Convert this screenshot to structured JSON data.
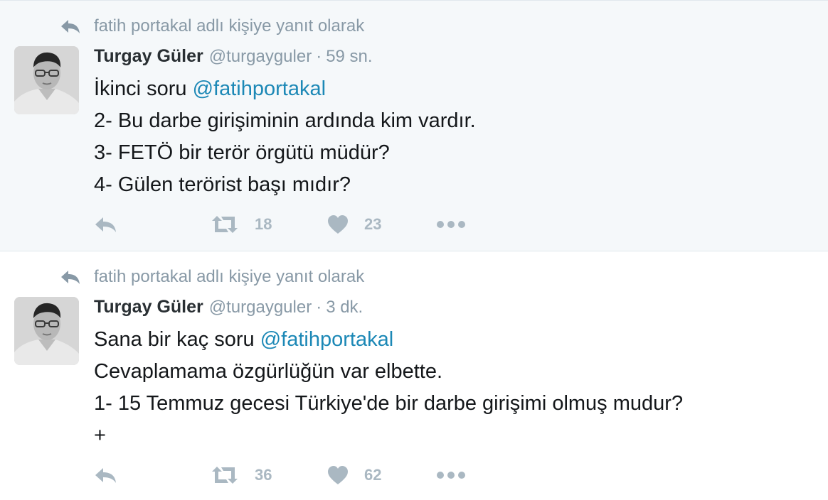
{
  "tweets": [
    {
      "context_text": "fatih portakal adlı kişiye yanıt olarak",
      "fullname": "Turgay Güler",
      "username": "@turgayguler",
      "separator": "·",
      "time": "59 sn.",
      "lines": [
        {
          "before": "İkinci soru ",
          "mention": "@fatihportakal"
        },
        {
          "before": "2- Bu darbe girişiminin ardında kim vardır.",
          "mention": ""
        },
        {
          "before": "3- FETÖ bir terör örgütü müdür?",
          "mention": ""
        },
        {
          "before": "4- Gülen terörist başı mıdır?",
          "mention": ""
        }
      ],
      "retweet_count": "18",
      "like_count": "23"
    },
    {
      "context_text": "fatih portakal adlı kişiye yanıt olarak",
      "fullname": "Turgay Güler",
      "username": "@turgayguler",
      "separator": "·",
      "time": "3 dk.",
      "lines": [
        {
          "before": "Sana bir kaç soru ",
          "mention": "@fatihportakal"
        },
        {
          "before": "Cevaplamama özgürlüğün var elbette.",
          "mention": ""
        },
        {
          "before": "1- 15 Temmuz gecesi Türkiye'de bir darbe girişimi olmuş mudur?",
          "mention": ""
        },
        {
          "before": "+",
          "mention": ""
        }
      ],
      "retweet_count": "36",
      "like_count": "62"
    }
  ],
  "icons": {
    "context": "reply-context-icon",
    "reply": "reply-icon",
    "retweet": "retweet-icon",
    "like": "heart-icon",
    "more": "more-dots-icon"
  },
  "colors": {
    "highlight_bg": "#f5f8fa",
    "mention": "#1c88b6",
    "muted": "#8899a6",
    "action": "#aab8c2"
  }
}
